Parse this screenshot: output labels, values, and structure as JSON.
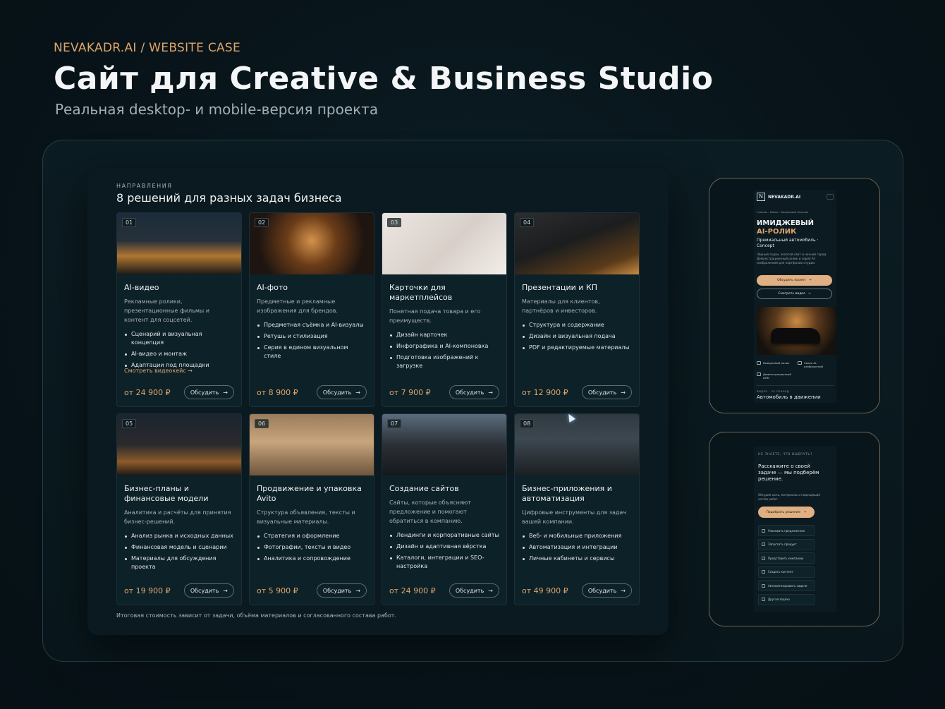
{
  "header": {
    "kicker": "NEVAKADR.AI / WEBSITE CASE",
    "title": "Сайт для Creative & Business Studio",
    "subtitle": "Реальная desktop- и mobile-версия проекта"
  },
  "desktop": {
    "kicker": "НАПРАВЛЕНИЯ",
    "heading": "8 решений для разных задач бизнеса",
    "discuss_label": "Обсудить",
    "footnote": "Итоговая стоимость зависит от задачи, объёма материалов и согласованного состава работ.",
    "cards": [
      {
        "num": "01",
        "title": "AI-видео",
        "desc": "Рекламные ролики, презентационные фильмы и контент для соцсетей.",
        "items": [
          "Сценарий и визуальная концепция",
          "AI-видео и монтаж",
          "Адаптации под площадки"
        ],
        "link": "Смотреть видеокейс",
        "price": "от 24 900 ₽"
      },
      {
        "num": "02",
        "title": "AI-фото",
        "desc": "Предметные и рекламные изображения для брендов.",
        "items": [
          "Предметная съёмка и AI-визуалы",
          "Ретушь и стилизация",
          "Серия в едином визуальном стиле"
        ],
        "link": "",
        "price": "от 8 900 ₽"
      },
      {
        "num": "03",
        "title": "Карточки для маркетплейсов",
        "desc": "Понятная подача товара и его преимуществ.",
        "items": [
          "Дизайн карточек",
          "Инфографика и AI-компоновка",
          "Подготовка изображений к загрузке"
        ],
        "link": "",
        "price": "от 7 900 ₽"
      },
      {
        "num": "04",
        "title": "Презентации и КП",
        "desc": "Материалы для клиентов, партнёров и инвесторов.",
        "items": [
          "Структура и содержание",
          "Дизайн и визуальная подача",
          "PDF и редактируемые материалы"
        ],
        "link": "",
        "price": "от 12 900 ₽"
      },
      {
        "num": "05",
        "title": "Бизнес-планы и финансовые модели",
        "desc": "Аналитика и расчёты для принятия бизнес-решений.",
        "items": [
          "Анализ рынка и исходных данных",
          "Финансовая модель и сценарии",
          "Материалы для обсуждения проекта"
        ],
        "link": "",
        "price": "от 19 900 ₽"
      },
      {
        "num": "06",
        "title": "Продвижение и упаковка Avito",
        "desc": "Структура объявления, тексты и визуальные материалы.",
        "items": [
          "Стратегия и оформление",
          "Фотографии, тексты и видео",
          "Аналитика и сопровождение"
        ],
        "link": "",
        "price": "от 5 900 ₽"
      },
      {
        "num": "07",
        "title": "Создание сайтов",
        "desc": "Сайты, которые объясняют предложение и помогают обратиться в компанию.",
        "items": [
          "Лендинги и корпоративные сайты",
          "Дизайн и адаптивная вёрстка",
          "Каталоги, интеграции и SEO-настройка"
        ],
        "link": "",
        "price": "от 24 900 ₽"
      },
      {
        "num": "08",
        "title": "Бизнес-приложения и автоматизация",
        "desc": "Цифровые инструменты для задач вашей компании.",
        "items": [
          "Веб- и мобильные приложения",
          "Автоматизация и интеграции",
          "Личные кабинеты и сервисы"
        ],
        "link": "",
        "price": "от 49 900 ₽"
      }
    ]
  },
  "mobile1": {
    "logo": "NEVAKADR.AI",
    "breadcrumb": "Главная  ›  Кейсы  ›  Имиджевый AI-ролик",
    "h1_line1": "ИМИДЖЕВЫЙ",
    "h1_line2": "AI-РОЛИК",
    "h2": "Премиальный автомобиль · Concept",
    "p": "Чёрный седан, золотой свет и ночной город. Демонстрационный ролик и серия AI-изображений для портфолио студии.",
    "btn_primary": "Обсудить проект",
    "btn_secondary": "Смотреть видео",
    "features": [
      "Имиджевый ролик",
      "Серия AI-изображений",
      "Демонстрационный кейс"
    ],
    "video_kicker": "ВИДЕО · 20 СЕКУНД",
    "video_title": "Автомобиль в движении"
  },
  "mobile2": {
    "kicker": "НЕ ЗНАЕТЕ, ЧТО ВЫБРАТЬ?",
    "title": "Расскажите о своей задаче — мы подберём решение.",
    "p": "Обсудим цель, материалы и подходящий состав работ.",
    "btn": "Подобрать решение",
    "items": [
      "Упаковать предложение",
      "Запустить продукт",
      "Представить компанию",
      "Создать контент",
      "Автоматизировать задачи",
      "Другая задача"
    ]
  },
  "colors": {
    "accent": "#e0a56a",
    "background": "#08141a",
    "card": "#0d2128"
  }
}
